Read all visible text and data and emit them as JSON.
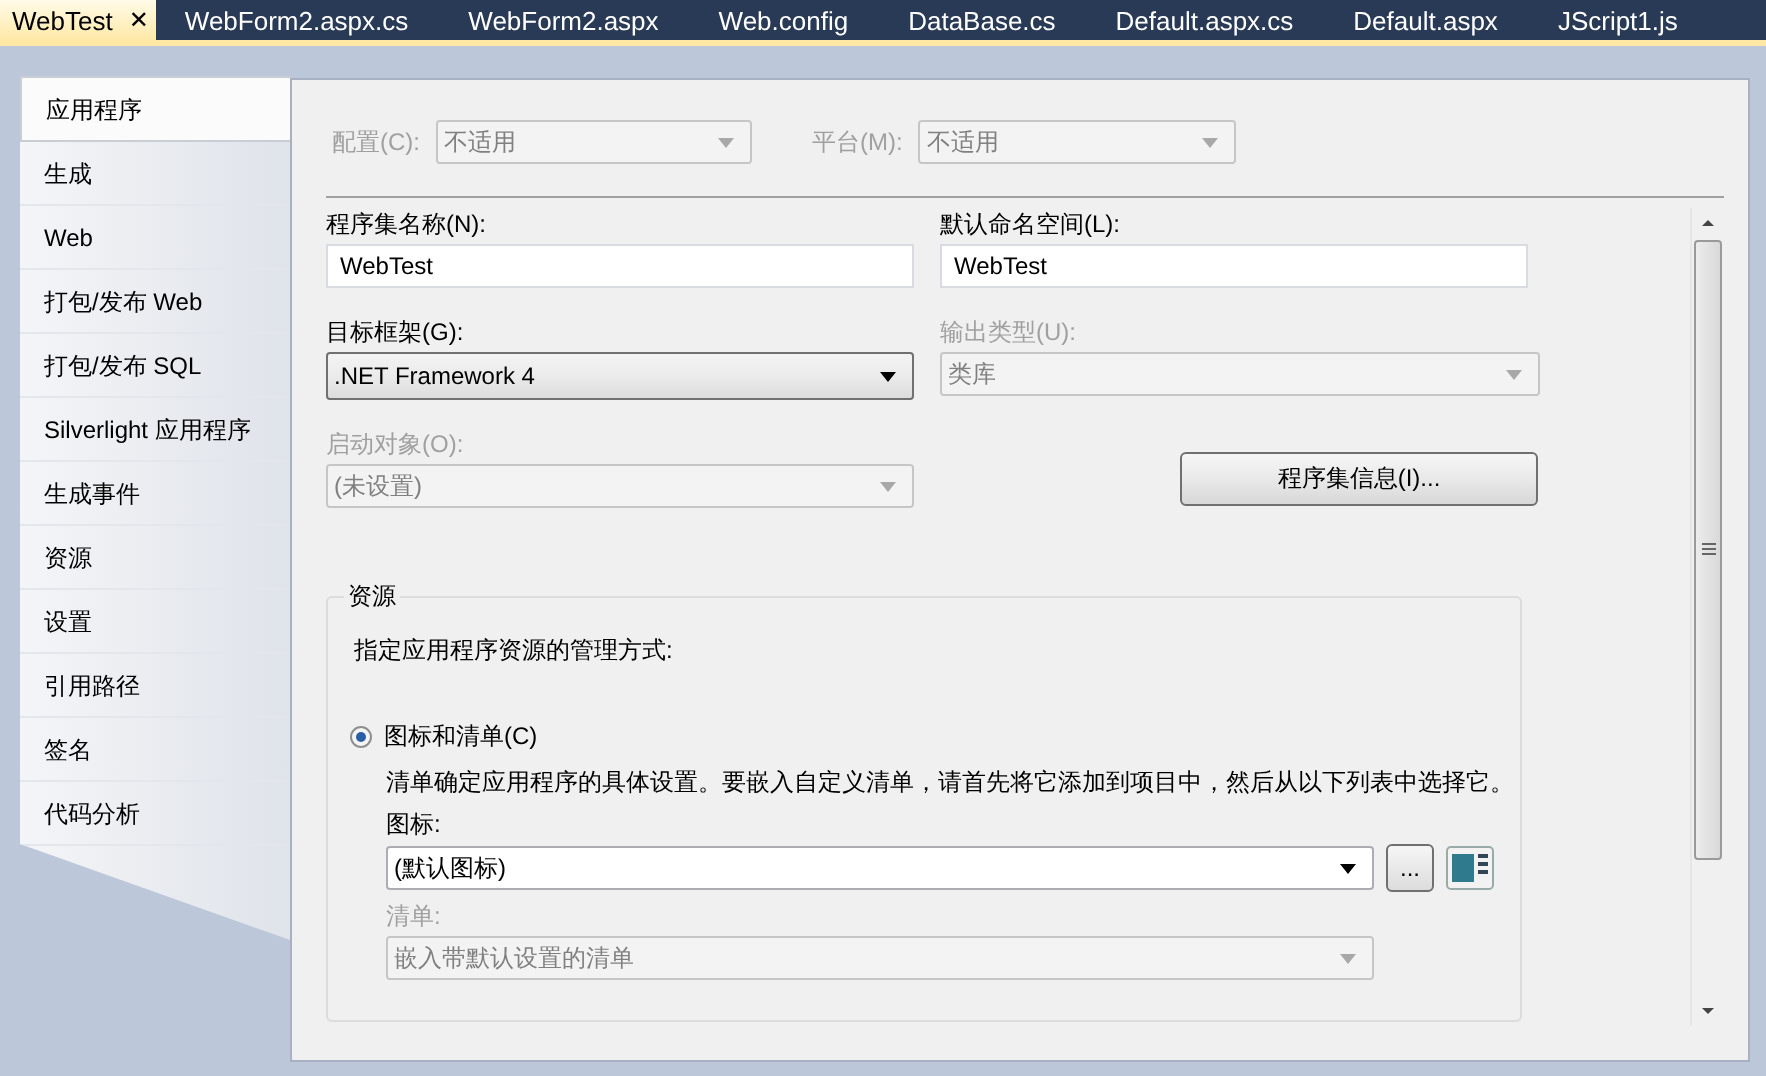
{
  "document_tabs": [
    {
      "label": "WebTest",
      "selected": true,
      "close": "✕"
    },
    {
      "label": "WebForm2.aspx.cs",
      "selected": false
    },
    {
      "label": "WebForm2.aspx",
      "selected": false
    },
    {
      "label": "Web.config",
      "selected": false
    },
    {
      "label": "DataBase.cs",
      "selected": false
    },
    {
      "label": "Default.aspx.cs",
      "selected": false
    },
    {
      "label": "Default.aspx",
      "selected": false
    },
    {
      "label": "JScript1.js",
      "selected": false
    }
  ],
  "sidebar": {
    "items": [
      {
        "label": "应用程序",
        "selected": true
      },
      {
        "label": "生成",
        "selected": false
      },
      {
        "label": "Web",
        "selected": false
      },
      {
        "label": "打包/发布 Web",
        "selected": false
      },
      {
        "label": "打包/发布 SQL",
        "selected": false
      },
      {
        "label": "Silverlight 应用程序",
        "selected": false
      },
      {
        "label": "生成事件",
        "selected": false
      },
      {
        "label": "资源",
        "selected": false
      },
      {
        "label": "设置",
        "selected": false
      },
      {
        "label": "引用路径",
        "selected": false
      },
      {
        "label": "签名",
        "selected": false
      },
      {
        "label": "代码分析",
        "selected": false
      }
    ]
  },
  "configuration": {
    "label": "配置(C):",
    "value": "不适用",
    "disabled": true
  },
  "platform": {
    "label": "平台(M):",
    "value": "不适用",
    "disabled": true
  },
  "assembly_name": {
    "label": "程序集名称(N):",
    "value": "WebTest"
  },
  "default_namespace": {
    "label": "默认命名空间(L):",
    "value": "WebTest"
  },
  "target_framework": {
    "label": "目标框架(G):",
    "value": ".NET Framework 4",
    "disabled": false
  },
  "output_type": {
    "label": "输出类型(U):",
    "value": "类库",
    "disabled": true
  },
  "startup_object": {
    "label": "启动对象(O):",
    "value": "(未设置)",
    "disabled": true
  },
  "assembly_info_button": "程序集信息(I)...",
  "resources": {
    "title": "资源",
    "description": "指定应用程序资源的管理方式:",
    "options": [
      {
        "label": "图标和清单(C)",
        "selected": true,
        "description": "清单确定应用程序的具体设置。要嵌入自定义清单，请首先将它添加到项目中，然后从以下列表中选择它。"
      }
    ],
    "icon": {
      "label": "图标:",
      "value": "(默认图标)",
      "disabled": false
    },
    "browse_button": "...",
    "manifest": {
      "label": "清单:",
      "value": "嵌入带默认设置的清单",
      "disabled": true
    }
  }
}
